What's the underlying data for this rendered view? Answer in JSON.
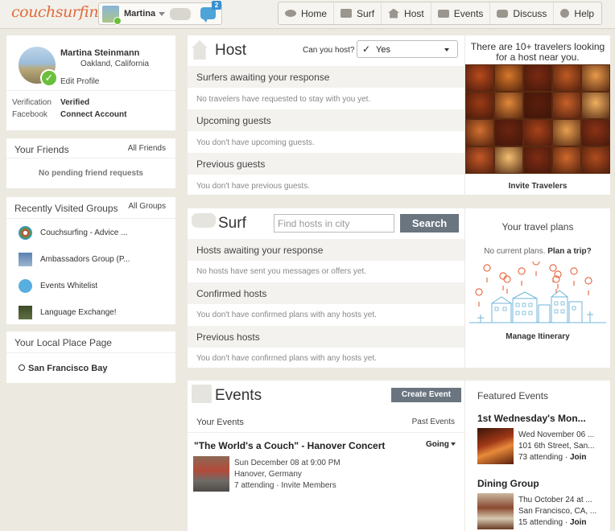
{
  "app": {
    "logo": "couchsurfing"
  },
  "user_menu": {
    "name": "Martina",
    "message_count": "2"
  },
  "nav": [
    {
      "label": "Home",
      "icon": "eye-icon"
    },
    {
      "label": "Surf",
      "icon": "couch-icon"
    },
    {
      "label": "Host",
      "icon": "house-icon"
    },
    {
      "label": "Events",
      "icon": "calendar-icon"
    },
    {
      "label": "Discuss",
      "icon": "speech-bubble-icon"
    },
    {
      "label": "Help",
      "icon": "help-icon"
    }
  ],
  "profile": {
    "name": "Martina Steinmann",
    "location": "Oakland, California",
    "edit_link": "Edit Profile",
    "verification_label": "Verification",
    "verification_value": "Verified",
    "facebook_label": "Facebook",
    "facebook_value": "Connect Account"
  },
  "friends": {
    "title": "Your Friends",
    "link": "All Friends",
    "empty": "No pending friend requests"
  },
  "groups": {
    "title": "Recently Visited Groups",
    "link": "All Groups",
    "items": [
      {
        "label": "Couchsurfing - Advice ..."
      },
      {
        "label": "Ambassadors Group (P..."
      },
      {
        "label": "Events Whitelist"
      },
      {
        "label": "Language Exchange!"
      }
    ]
  },
  "local_place": {
    "title": "Your Local Place Page",
    "place": "San Francisco Bay"
  },
  "host": {
    "title": "Host",
    "can_host_label": "Can you host?",
    "can_host_value": "Yes",
    "sections": [
      {
        "title": "Surfers awaiting your response",
        "note": "No travelers have requested to stay with you yet."
      },
      {
        "title": "Upcoming guests",
        "note": "You don't have upcoming guests."
      },
      {
        "title": "Previous guests",
        "note": "You don't have previous guests."
      }
    ]
  },
  "travelers": {
    "title": "There are 10+ travelers looking for a host near you.",
    "invite": "Invite Travelers",
    "photo_colors": [
      "#b84a1e",
      "#d8782a",
      "#7a2a12",
      "#c05a24",
      "#e89a4a",
      "#9a3a16",
      "#e0883a",
      "#5a1e0c",
      "#c8602a",
      "#f0b060",
      "#d27030",
      "#6a2410",
      "#a8421a",
      "#e8a050",
      "#8a3216",
      "#c45828",
      "#f4c070",
      "#7e2c14",
      "#d0682c",
      "#b04c1e"
    ]
  },
  "surf": {
    "title": "Surf",
    "search_placeholder": "Find hosts in city",
    "search_button": "Search",
    "sections": [
      {
        "title": "Hosts awaiting your response",
        "note": "No hosts have sent you messages or offers yet."
      },
      {
        "title": "Confirmed hosts",
        "note": "You don't have confirmed plans with any hosts yet."
      },
      {
        "title": "Previous hosts",
        "note": "You don't have confirmed plans with any hosts yet."
      }
    ]
  },
  "travel_plans": {
    "title": "Your travel plans",
    "none": "No current plans.",
    "plan_link": "Plan a trip?",
    "manage": "Manage Itinerary"
  },
  "events": {
    "title": "Events",
    "create_button": "Create Event",
    "your_events": "Your Events",
    "past_events": "Past Events",
    "item": {
      "title": "\"The World's a Couch\" - Hanover Concert",
      "status": "Going",
      "date": "Sun December 08 at 9:00 PM",
      "location": "Hanover, Germany",
      "attending": "7 attending",
      "invite": "Invite Members"
    }
  },
  "featured": {
    "title": "Featured Events",
    "items": [
      {
        "name": "1st Wednesday's Mon...",
        "date": "Wed November 06 ...",
        "address": "101 6th Street, San...",
        "attending": "73 attending",
        "join": "Join"
      },
      {
        "name": "Dining Group",
        "date": "Thu October 24 at ...",
        "address": "San Francisco, CA, ...",
        "attending": "15 attending",
        "join": "Join"
      }
    ]
  },
  "colors": {
    "accent": "#e06b3c",
    "button": "#6a7580",
    "verified": "#6cbf3c",
    "message": "#4ea3d8"
  }
}
